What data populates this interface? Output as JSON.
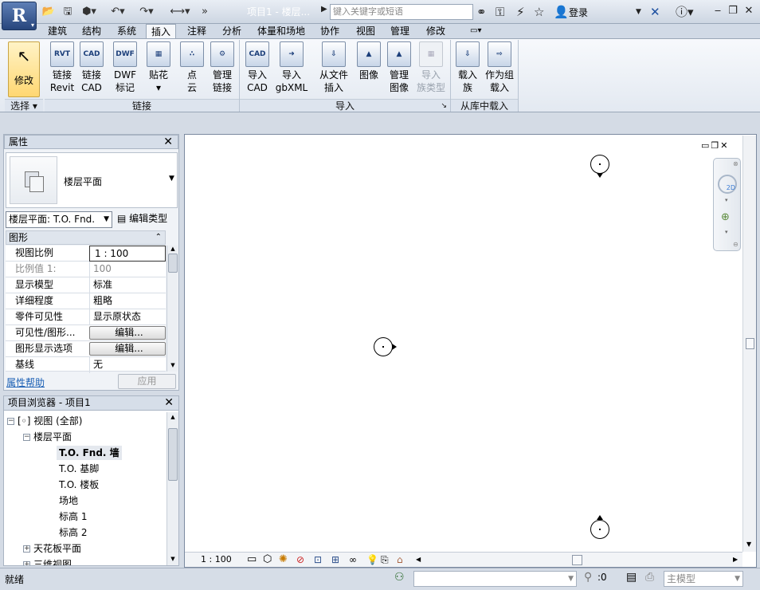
{
  "app": {
    "title": "项目1 - 楼层...",
    "search_placeholder": "键入关键字或短语",
    "login": "登录"
  },
  "tabs": [
    "建筑",
    "结构",
    "系统",
    "插入",
    "注释",
    "分析",
    "体量和场地",
    "协作",
    "视图",
    "管理",
    "修改"
  ],
  "active_tab": "插入",
  "ribbon": {
    "modify": {
      "label": "修改"
    },
    "select_panel": "选择",
    "link_panel": "链接",
    "import_panel": "导入",
    "load_panel": "从库中载入",
    "buttons": {
      "link_revit": {
        "l1": "链接",
        "l2": "Revit",
        "icon": "RVT"
      },
      "link_cad": {
        "l1": "链接",
        "l2": "CAD",
        "icon": "CAD"
      },
      "dwf": {
        "l1": "DWF",
        "l2": "标记",
        "icon": "DWF"
      },
      "decal": {
        "l1": "贴花",
        "l2": "▾",
        "icon": "▦"
      },
      "pointcloud": {
        "l1": "点",
        "l2": "云",
        "icon": "∴"
      },
      "manage_links": {
        "l1": "管理",
        "l2": "链接",
        "icon": "⚙"
      },
      "import_cad": {
        "l1": "导入",
        "l2": "CAD",
        "icon": "CAD"
      },
      "import_gbxml": {
        "l1": "导入",
        "l2": "gbXML",
        "icon": "➜"
      },
      "insert_from_file": {
        "l1": "从文件",
        "l2": "插入",
        "icon": "⇩"
      },
      "image": {
        "l1": "图像",
        "l2": "",
        "icon": "▲"
      },
      "manage_images": {
        "l1": "管理",
        "l2": "图像",
        "icon": "▲"
      },
      "import_family_types": {
        "l1": "导入",
        "l2": "族类型",
        "icon": "▦"
      },
      "load_family": {
        "l1": "载入",
        "l2": "族",
        "icon": "⇩"
      },
      "load_as_group": {
        "l1": "作为组",
        "l2": "载入",
        "icon": "⇨"
      }
    }
  },
  "properties": {
    "title": "属性",
    "type_name": "楼层平面",
    "selector": "楼层平面: T.O. Fnd.",
    "edit_type": "编辑类型",
    "section": "图形",
    "rows": [
      {
        "k": "视图比例",
        "v": "1 : 100"
      },
      {
        "k": "比例值 1:",
        "v": "100"
      },
      {
        "k": "显示模型",
        "v": "标准"
      },
      {
        "k": "详细程度",
        "v": "粗略"
      },
      {
        "k": "零件可见性",
        "v": "显示原状态"
      },
      {
        "k": "可见性/图形...",
        "v": "编辑..."
      },
      {
        "k": "图形显示选项",
        "v": "编辑..."
      },
      {
        "k": "基线",
        "v": "无"
      }
    ],
    "help": "属性帮助",
    "apply": "应用"
  },
  "browser": {
    "title": "项目浏览器 - 项目1",
    "nodes": [
      {
        "label": "视图 (全部)"
      },
      {
        "label": "楼层平面"
      },
      {
        "label": "T.O. Fnd. 墙"
      },
      {
        "label": "T.O. 基脚"
      },
      {
        "label": "T.O. 楼板"
      },
      {
        "label": "场地"
      },
      {
        "label": "标高 1"
      },
      {
        "label": "标高 2"
      },
      {
        "label": "天花板平面"
      },
      {
        "label": "三维视图"
      }
    ]
  },
  "view": {
    "scale": "1 : 100"
  },
  "status": {
    "text": "就绪",
    "selection_count": ":0",
    "model": "主模型"
  }
}
